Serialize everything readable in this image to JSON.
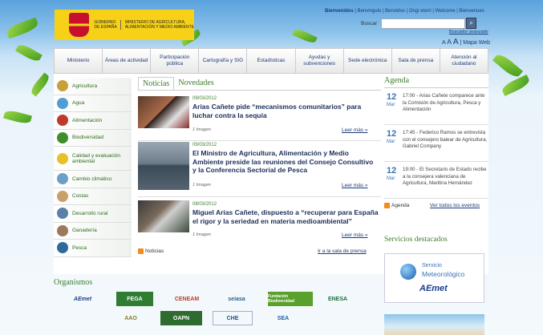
{
  "header": {
    "gov_text": "GOBIERNO DE ESPAÑA",
    "ministry_text": "MINISTERIO DE AGRICULTURA, ALIMENTACIÓN Y MEDIO AMBIENTE",
    "welcome": "Bienvenidos",
    "languages": "| Benvinguts | Benvidos | Ongi etorri | Welcome | Bienvenues",
    "search_label": "Buscar",
    "search_value": "",
    "advanced_search": "Buscador avanzado",
    "font_a1": "A",
    "font_a2": "A",
    "font_a3": "A",
    "sitemap": "| Mapa Web"
  },
  "nav": [
    {
      "label": "Ministerio"
    },
    {
      "label": "Áreas de actividad"
    },
    {
      "label": "Participación pública"
    },
    {
      "label": "Cartografía y SIG"
    },
    {
      "label": "Estadísticas"
    },
    {
      "label": "Ayudas y subvenciones"
    },
    {
      "label": "Sede electrónica"
    },
    {
      "label": "Sala de prensa"
    },
    {
      "label": "Atención al ciudadano"
    }
  ],
  "sidebar": [
    {
      "label": "Agricultura",
      "color": "#c8a03a"
    },
    {
      "label": "Agua",
      "color": "#4f9fd6"
    },
    {
      "label": "Alimentación",
      "color": "#c0392b"
    },
    {
      "label": "Biodiversidad",
      "color": "#3e8e2a"
    },
    {
      "label": "Calidad y evaluación ambiental",
      "color": "#e6c12a"
    },
    {
      "label": "Cambio climático",
      "color": "#6aa0c8"
    },
    {
      "label": "Costas",
      "color": "#c9a06a"
    },
    {
      "label": "Desarrollo rural",
      "color": "#5b7fa6"
    },
    {
      "label": "Ganadería",
      "color": "#9a7a5a"
    },
    {
      "label": "Pesca",
      "color": "#2d6a9a"
    }
  ],
  "tabs": {
    "noticias": "Noticias",
    "novedades": "Novedades"
  },
  "news": [
    {
      "date": "09/03/2012",
      "title": "Arias Cañete pide “mecanismos comunitarios” para luchar contra la sequía",
      "images": "1 Imagen",
      "more": "Leer más »"
    },
    {
      "date": "09/03/2012",
      "title": "El Ministro de Agricultura, Alimentación y Medio Ambiente preside las reuniones del Consejo Consultivo y la Conferencia Sectorial de Pesca",
      "images": "1 Imagen",
      "more": "Leer más »"
    },
    {
      "date": "08/03/2012",
      "title": "Miguel Arias Cañete, dispuesto a “recuperar para España el rigor y la seriedad en materia medioambiental”",
      "images": "1 Imagen",
      "more": "Leer más »"
    }
  ],
  "news_footer": {
    "rss": "Noticias",
    "press": "Ir a la sala de prensa"
  },
  "agenda": {
    "title": "Agenda",
    "events": [
      {
        "day": "12",
        "month": "Mar",
        "text": "17:00 - Arias Cañete comparece ante la Comisión de Agricultura, Pesca y Alimentación"
      },
      {
        "day": "12",
        "month": "Mar",
        "text": "17:45 - Federico Ramos se entrevista con el consejero balear de Agricultura, Gabriel Company"
      },
      {
        "day": "12",
        "month": "Mar",
        "text": "19:00 - El Secretario de Estado recibe a la consejera valenciana de Agricultura, Maritina Hernández"
      }
    ],
    "rss": "Agenda",
    "see_all": "Ver todos los eventos"
  },
  "services": {
    "title": "Servicios destacados",
    "line1": "Servicio",
    "line2": "Meteorológico",
    "aemet": "AEmet"
  },
  "organismos": {
    "title": "Organismos",
    "items": [
      {
        "label": "AEmet",
        "color": "#1e3f8a"
      },
      {
        "label": "FEGA",
        "color": "#2e7d32"
      },
      {
        "label": "CENEAM",
        "color": "#c0392b"
      },
      {
        "label": "seiasa",
        "color": "#2b5f8a"
      },
      {
        "label": "Fundación Biodiversidad",
        "color": "#5aa02c"
      },
      {
        "label": "ENESA",
        "color": "#1f6b3a"
      },
      {
        "label": "AAO",
        "color": "#8a7a1e"
      },
      {
        "label": "OAPN",
        "color": "#2e6b2e"
      },
      {
        "label": "CHE",
        "color": "#1b4f8a"
      },
      {
        "label": "SEA",
        "color": "#1f5fa6"
      }
    ]
  }
}
